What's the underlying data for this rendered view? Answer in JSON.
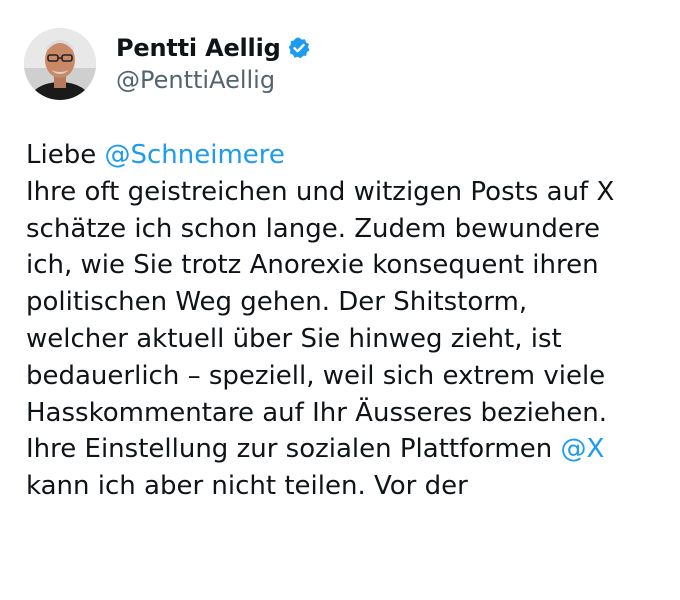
{
  "tweet": {
    "author": {
      "display_name": "Pentti Aellig",
      "handle": "@PenttiAellig",
      "verified": true,
      "avatar_icon": "avatar-photo"
    },
    "text_lines": [
      "Liebe ",
      "Ihre oft geistreichen und witzigen Posts auf X",
      "schätze ich schon lange. Zudem bewundere",
      "ich, wie Sie trotz Anorexie konsequent ihren",
      "politischen Weg gehen. Der Shitstorm,",
      "welcher aktuell über Sie hinweg zieht, ist",
      "bedauerlich – speziell, weil sich extrem viele",
      "Hasskommentare auf Ihr Äusseres beziehen.",
      "Ihre Einstellung zur sozialen Plattformen ",
      "kann ich aber nicht teilen. Vor der"
    ],
    "mentions": {
      "greeting": "@Schneimere",
      "platform": "@X"
    }
  },
  "colors": {
    "text": "#0f1419",
    "secondary": "#536471",
    "accent": "#1d9bf0"
  }
}
